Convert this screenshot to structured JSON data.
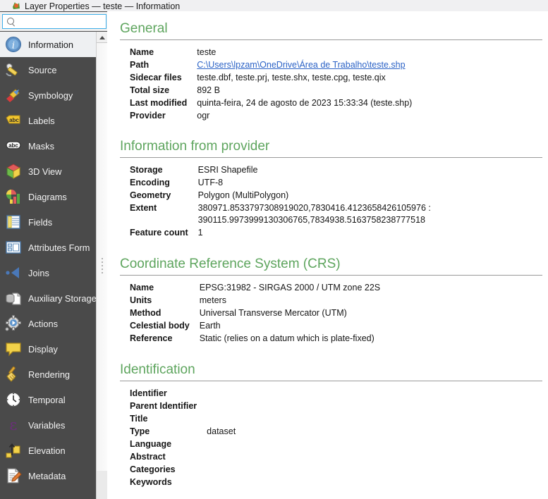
{
  "window": {
    "title": "Layer Properties — teste — Information",
    "icon": "qgis-logo-icon"
  },
  "search": {
    "value": "",
    "placeholder": "",
    "icon": "search-icon"
  },
  "sidebar": {
    "items": [
      {
        "label": "Information",
        "icon": "information-icon",
        "selected": true
      },
      {
        "label": "Source",
        "icon": "source-wrench-icon",
        "selected": false
      },
      {
        "label": "Symbology",
        "icon": "symbology-brush-icon",
        "selected": false
      },
      {
        "label": "Labels",
        "icon": "labels-abc-tag-icon",
        "selected": false
      },
      {
        "label": "Masks",
        "icon": "masks-abc-icon",
        "selected": false
      },
      {
        "label": "3D View",
        "icon": "3d-cube-icon",
        "selected": false
      },
      {
        "label": "Diagrams",
        "icon": "diagrams-chart-icon",
        "selected": false
      },
      {
        "label": "Fields",
        "icon": "fields-table-icon",
        "selected": false
      },
      {
        "label": "Attributes Form",
        "icon": "attributes-form-icon",
        "selected": false
      },
      {
        "label": "Joins",
        "icon": "joins-arrow-icon",
        "selected": false
      },
      {
        "label": "Auxiliary Storage",
        "icon": "auxiliary-storage-icon",
        "selected": false
      },
      {
        "label": "Actions",
        "icon": "actions-gear-icon",
        "selected": false
      },
      {
        "label": "Display",
        "icon": "display-balloon-icon",
        "selected": false
      },
      {
        "label": "Rendering",
        "icon": "rendering-broom-icon",
        "selected": false
      },
      {
        "label": "Temporal",
        "icon": "temporal-clock-icon",
        "selected": false
      },
      {
        "label": "Variables",
        "icon": "variables-epsilon-icon",
        "selected": false
      },
      {
        "label": "Elevation",
        "icon": "elevation-arrow-icon",
        "selected": false
      },
      {
        "label": "Metadata",
        "icon": "metadata-pencil-icon",
        "selected": false
      }
    ],
    "scrollbar": {
      "up_arrow": "scroll-up-arrow-icon"
    }
  },
  "content": {
    "general": {
      "heading": "General",
      "rows": [
        {
          "key": "Name",
          "value": "teste"
        },
        {
          "key": "Path",
          "value": "C:\\Users\\lpzam\\OneDrive\\Área de Trabalho\\teste.shp",
          "link": true
        },
        {
          "key": "Sidecar files",
          "value": "teste.dbf, teste.prj, teste.shx, teste.cpg, teste.qix"
        },
        {
          "key": "Total size",
          "value": "892 B"
        },
        {
          "key": "Last modified",
          "value": "quinta-feira, 24 de agosto de 2023 15:33:34 (teste.shp)"
        },
        {
          "key": "Provider",
          "value": "ogr"
        }
      ]
    },
    "provider": {
      "heading": "Information from provider",
      "rows": [
        {
          "key": "Storage",
          "value": "ESRI Shapefile"
        },
        {
          "key": "Encoding",
          "value": "UTF-8"
        },
        {
          "key": "Geometry",
          "value": "Polygon (MultiPolygon)"
        },
        {
          "key": "Extent",
          "value": "380971.8533797308919020,7830416.4123658426105976 :\n390115.9973999130306765,7834938.5163758238777518"
        },
        {
          "key": "Feature count",
          "value": "1"
        }
      ]
    },
    "crs": {
      "heading": "Coordinate Reference System (CRS)",
      "rows": [
        {
          "key": "Name",
          "value": "EPSG:31982 - SIRGAS 2000 / UTM zone 22S"
        },
        {
          "key": "Units",
          "value": "meters"
        },
        {
          "key": "Method",
          "value": "Universal Transverse Mercator (UTM)"
        },
        {
          "key": "Celestial body",
          "value": "Earth"
        },
        {
          "key": "Reference",
          "value": "Static (relies on a datum which is plate-fixed)"
        }
      ]
    },
    "identification": {
      "heading": "Identification",
      "rows": [
        {
          "key": "Identifier",
          "value": ""
        },
        {
          "key": "Parent Identifier",
          "value": ""
        },
        {
          "key": "Title",
          "value": ""
        },
        {
          "key": "Type",
          "value": "dataset"
        },
        {
          "key": "Language",
          "value": ""
        },
        {
          "key": "Abstract",
          "value": ""
        },
        {
          "key": "Categories",
          "value": ""
        },
        {
          "key": "Keywords",
          "value": ""
        }
      ]
    }
  },
  "colors": {
    "heading_green": "#5ea55e",
    "link_blue": "#2b62c6",
    "sidebar_bg": "#4a4a4a",
    "selected_bg": "#eef0f2",
    "focus_blue": "#3daee9"
  }
}
